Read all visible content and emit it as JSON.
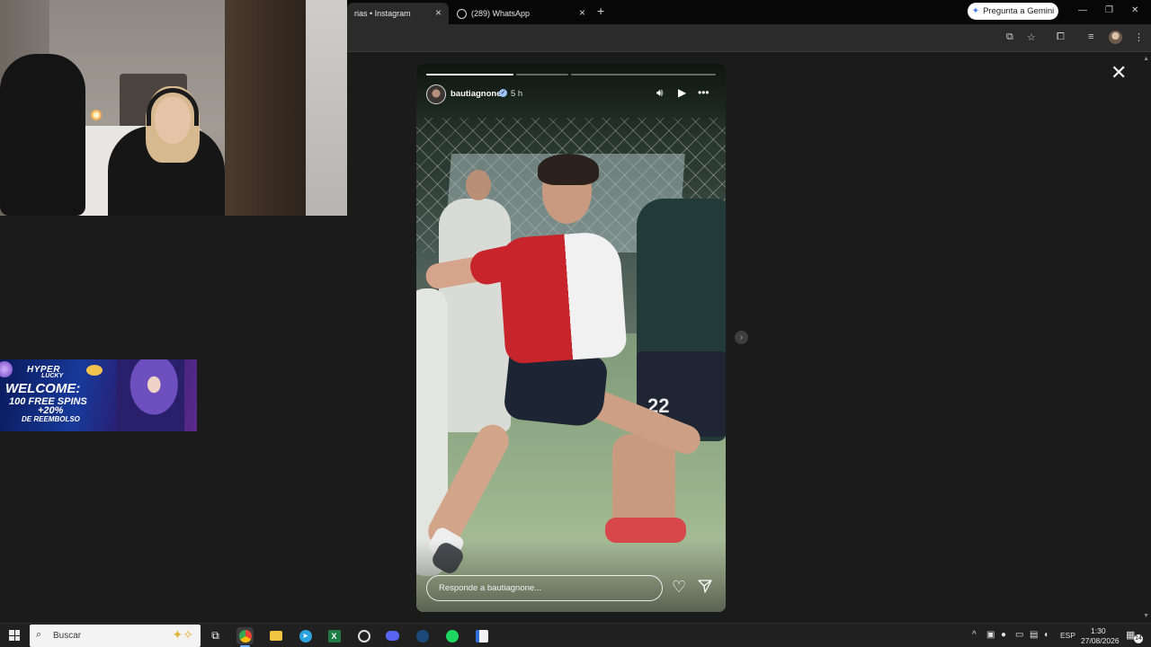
{
  "browser": {
    "tabs": [
      {
        "label": "rias • Instagram",
        "active": true
      },
      {
        "label": "(289) WhatsApp",
        "active": false
      }
    ],
    "new_tab_icon": "+",
    "gemini_button": "Pregunta a Gemini",
    "close_tab_icon": "×"
  },
  "story": {
    "username": "bautiagnone",
    "time_ago": "5 h",
    "reply_placeholder": "Responde a bautiagnone...",
    "progress": [
      1.0,
      0.0,
      0.0
    ],
    "player_number": "22",
    "close_icon": "✕"
  },
  "ad": {
    "brand_line1": "HYPER",
    "brand_line2": "LUCKY",
    "line1": "WELCOME:",
    "line2": "100 FREE SPINS",
    "line3": "+20%",
    "line4": "DE REEMBOLSO"
  },
  "taskbar": {
    "search_placeholder": "Buscar",
    "language": "ESP",
    "time": "1:30",
    "date": "27/08/2026",
    "notifications": "14"
  }
}
